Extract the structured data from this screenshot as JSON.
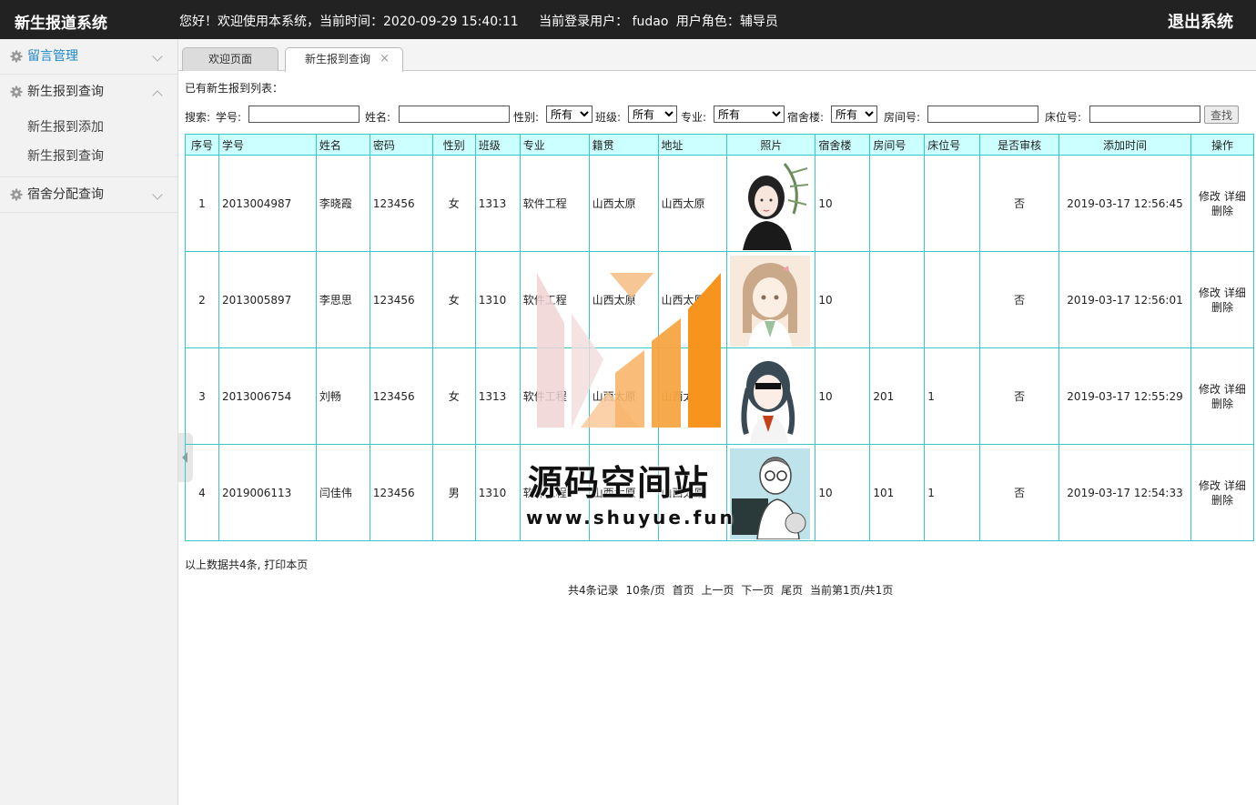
{
  "header": {
    "brand": "新生报道系统",
    "greeting": "您好！欢迎使用本系统，当前时间：2020-09-29 15:40:11",
    "user_label": "当前登录用户： fudao",
    "role_label": "用户角色：辅导员",
    "logout": "退出系统"
  },
  "sidebar": {
    "groups": [
      {
        "label": "留言管理",
        "expanded": false
      },
      {
        "label": "新生报到查询",
        "expanded": true,
        "items": [
          "新生报到添加",
          "新生报到查询"
        ]
      },
      {
        "label": "宿舍分配查询",
        "expanded": false
      }
    ]
  },
  "tabs": [
    {
      "label": "欢迎页面"
    },
    {
      "label": "新生报到查询",
      "close": "×"
    }
  ],
  "list_title": "已有新生报到列表：",
  "search": {
    "prefix": "搜索:",
    "student_no_label": "学号:",
    "name_label": "姓名:",
    "gender_label": "性别:",
    "gender_value": "所有",
    "class_label": "班级:",
    "class_value": "所有",
    "major_label": "专业:",
    "major_value": "所有",
    "dorm_label": "宿舍楼:",
    "dorm_value": "所有",
    "room_label": "房间号:",
    "bed_label": "床位号:",
    "search_button": "查找"
  },
  "table": {
    "columns": [
      "序号",
      "学号",
      "姓名",
      "密码",
      "性别",
      "班级",
      "专业",
      "籍贯",
      "地址",
      "照片",
      "宿舍楼",
      "房间号",
      "床位号",
      "是否审核",
      "添加时间",
      "操作"
    ],
    "rows": [
      {
        "no": "1",
        "sid": "2013004987",
        "name": "李晓霞",
        "pwd": "123456",
        "gender": "女",
        "class": "1313",
        "major": "软件工程",
        "origin": "山西太原",
        "addr": "山西太原",
        "photo": "girl-avatar-1",
        "dorm": "10",
        "room": "",
        "bed": "",
        "audited": "否",
        "time": "2019-03-17 12:56:45"
      },
      {
        "no": "2",
        "sid": "2013005897",
        "name": "李思思",
        "pwd": "123456",
        "gender": "女",
        "class": "1310",
        "major": "软件工程",
        "origin": "山西太原",
        "addr": "山西太原",
        "photo": "girl-avatar-2",
        "dorm": "10",
        "room": "",
        "bed": "",
        "audited": "否",
        "time": "2019-03-17 12:56:01"
      },
      {
        "no": "3",
        "sid": "2013006754",
        "name": "刘畅",
        "pwd": "123456",
        "gender": "女",
        "class": "1313",
        "major": "软件工程",
        "origin": "山西太原",
        "addr": "山西太原",
        "photo": "girl-avatar-3",
        "dorm": "10",
        "room": "201",
        "bed": "1",
        "audited": "否",
        "time": "2019-03-17 12:55:29"
      },
      {
        "no": "4",
        "sid": "2019006113",
        "name": "闫佳伟",
        "pwd": "123456",
        "gender": "男",
        "class": "1310",
        "major": "软件工程",
        "origin": "山西太原",
        "addr": "山西太原",
        "photo": "boy-avatar",
        "dorm": "10",
        "room": "101",
        "bed": "1",
        "audited": "否",
        "time": "2019-03-17 12:54:33"
      }
    ],
    "ops": {
      "edit": "修改",
      "detail": "详细",
      "delete": "删除"
    }
  },
  "summary": {
    "text": "以上数据共4条,",
    "print": "打印本页"
  },
  "pager": {
    "total": "共4条记录",
    "per_page": "10条/页",
    "first": "首页",
    "prev": "上一页",
    "next": "下一页",
    "last": "尾页",
    "current": "当前第1页/共1页"
  },
  "watermark": {
    "cn": "源码空间站",
    "url": "www.shuyue.fun"
  },
  "colors": {
    "topbar": "#222222",
    "header_cell": "#ccffff",
    "table_border": "#39c6c6",
    "accent": "#1e88c8",
    "wm_orange": "#f7941d"
  }
}
